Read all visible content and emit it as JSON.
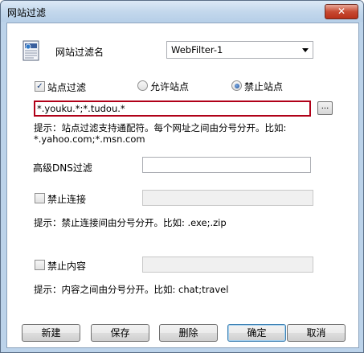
{
  "window": {
    "title": "网站过滤",
    "close_glyph": "✕"
  },
  "filter_name": {
    "label": "网站过滤名",
    "value": "WebFilter-1"
  },
  "site_filter": {
    "checkbox_label": "站点过滤",
    "checked": true,
    "allow_label": "允许站点",
    "block_label": "禁止站点",
    "selected": "block",
    "value": "*.youku.*;*.tudou.*",
    "browse_label": "...",
    "hint_line1": "提示：站点过滤支持通配符。每个网址之间由分号分开。比如:",
    "hint_line2": "*.yahoo.com;*.msn.com"
  },
  "dns_filter": {
    "label": "高级DNS过滤",
    "value": ""
  },
  "block_connection": {
    "checkbox_label": "禁止连接",
    "checked": false,
    "value": "",
    "hint": "提示：禁止连接间由分号分开。比如: .exe;.zip"
  },
  "block_content": {
    "checkbox_label": "禁止内容",
    "checked": false,
    "value": "",
    "hint": "提示：内容之间由分号分开。比如: chat;travel"
  },
  "buttons": {
    "new": "新建",
    "save": "保存",
    "delete": "删除",
    "ok": "确定",
    "cancel": "取消"
  },
  "icons": {
    "filter_name": "document-icon",
    "dropdown": "chevron-down-icon"
  }
}
